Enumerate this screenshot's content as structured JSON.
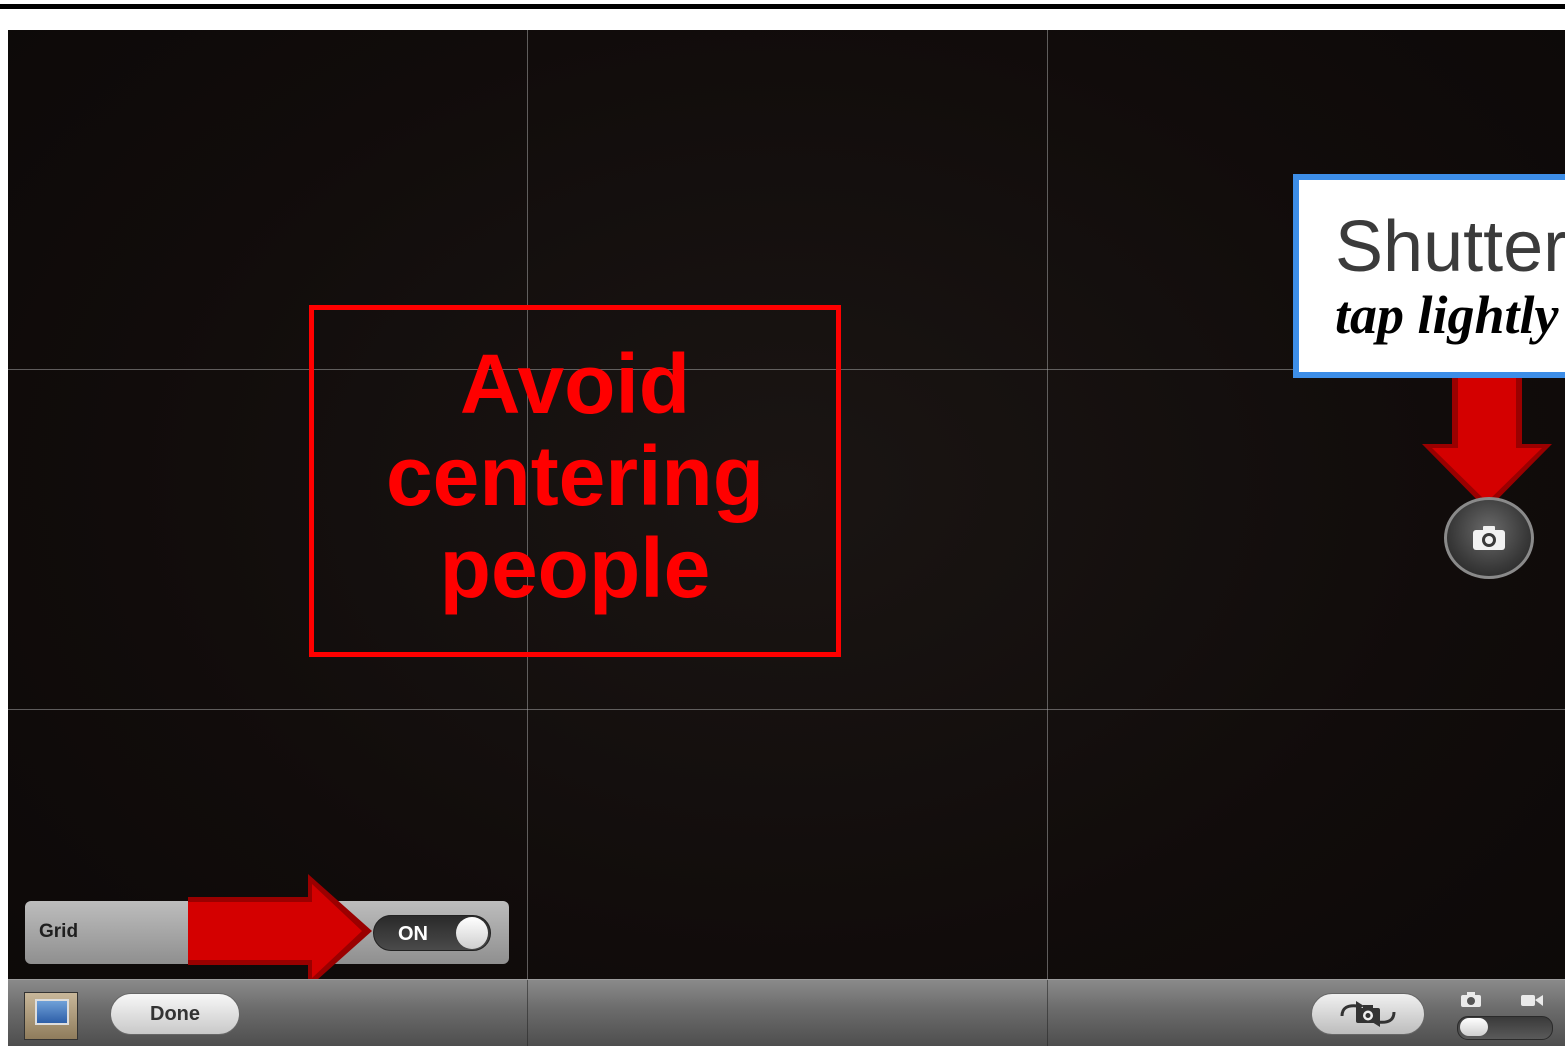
{
  "annotations": {
    "avoid_text": "Avoid centering people",
    "shutter_title": "Shutter",
    "shutter_subtitle": "tap lightly"
  },
  "grid_setting": {
    "label": "Grid",
    "toggle_value": "ON"
  },
  "toolbar": {
    "done_label": "Done"
  },
  "colors": {
    "annotation_red": "#ff0000",
    "arrow_red": "#cc0000",
    "callout_border_blue": "#3d8ee8"
  },
  "icons": {
    "shutter": "camera-icon",
    "flip": "camera-flip-icon",
    "mode_photo": "camera-mode-icon",
    "mode_video": "video-mode-icon",
    "thumbnail": "photo-thumbnail-icon"
  }
}
